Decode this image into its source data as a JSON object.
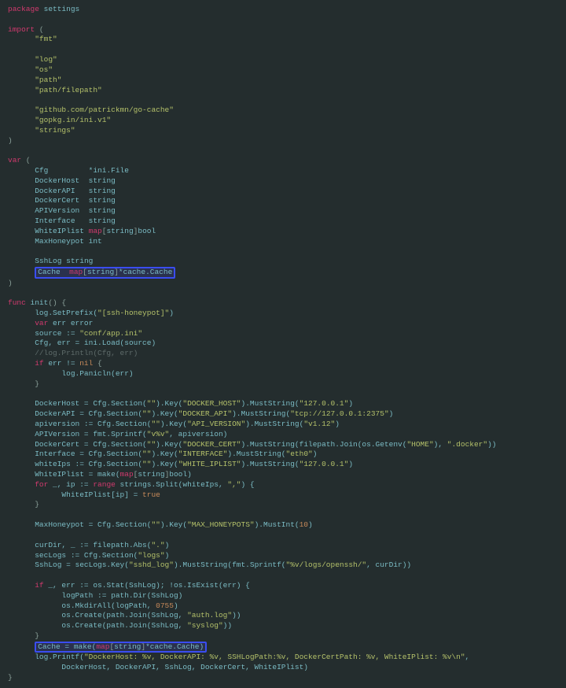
{
  "code": {
    "pkg_keyword": "package",
    "pkg_name": "settings",
    "import_keyword": "import",
    "imports": {
      "i0": "\"fmt\"",
      "i1": "\"log\"",
      "i2": "\"os\"",
      "i3": "\"path\"",
      "i4": "\"path/filepath\"",
      "i5": "\"github.com/patrickmn/go-cache\"",
      "i6": "\"gopkg.in/ini.v1\"",
      "i7": "\"strings\""
    },
    "var_keyword": "var",
    "vars": {
      "cfg_name": "Cfg",
      "cfg_type": "*ini.File",
      "dh_name": "DockerHost",
      "dh_type": "string",
      "da_name": "DockerAPI",
      "da_type": "string",
      "dc_name": "DockerCert",
      "dc_type": "string",
      "av_name": "APIVersion",
      "av_type": "string",
      "if_name": "Interface",
      "if_type": "string",
      "wip_name": "WhiteIPlist",
      "mh_name": "MaxHoneypot",
      "mh_type": "int",
      "ssh_name": "SshLog",
      "ssh_type": "string",
      "cache_name": "Cache"
    },
    "map_kw": "map",
    "string_kw": "string",
    "bool_kw": "bool",
    "cache_type": "*cache.Cache",
    "func_kw": "func",
    "init_name": "init",
    "body": {
      "l_setprefix_a": "log.SetPrefix(",
      "l_setprefix_str": "\"[ssh-honeypot]\"",
      "l_setprefix_b": ")",
      "l_var_err": "var",
      "l_err_decl": " err error",
      "l_source": "source := ",
      "l_source_str": "\"conf/app.ini\"",
      "l_cfgload_a": "Cfg, err = ini.Load(source)",
      "l_cmt": "//log.Println(Cfg, err)",
      "l_if_kw": "if",
      "l_if_cond": " err != ",
      "l_nil": "nil",
      "l_brace_open": " {",
      "l_panic": "log.Panicln(err)",
      "l_brace_close": "}",
      "l_dh": "DockerHost = Cfg.Section(",
      "s_empty": "\"\"",
      "l_key": ").Key(",
      "s_docker_host": "\"DOCKER_HOST\"",
      "l_muststr": ").MustString(",
      "s_127": "\"127.0.0.1\"",
      "l_close": ")",
      "l_da": "DockerAPI = Cfg.Section(",
      "s_docker_api": "\"DOCKER_API\"",
      "s_tcp": "\"tcp://127.0.0.1:2375\"",
      "l_apiv": "apiversion := Cfg.Section(",
      "s_api_ver": "\"API_VERSION\"",
      "s_v112": "\"v1.12\"",
      "l_apiv2": "APIVersion = fmt.Sprintf(",
      "s_vpv": "\"v%v\"",
      "l_apiv2b": ", apiversion)",
      "l_dc": "DockerCert = Cfg.Section(",
      "s_docker_cert": "\"DOCKER_CERT\"",
      "l_dc2": ").MustString(filepath.Join(os.Getenv(",
      "s_home": "\"HOME\"",
      "l_dc3": "), ",
      "s_dotdocker": "\".docker\"",
      "l_dc4": "))",
      "l_iface": "Interface = Cfg.Section(",
      "s_iface": "\"INTERFACE\"",
      "s_eth0": "\"eth0\"",
      "l_wips": "whiteIps := Cfg.Section(",
      "s_wiplist": "\"WHITE_IPLIST\"",
      "l_wipl_a": "WhiteIPlist = make(",
      "l_for_kw": "for",
      "l_for_a": " _, ip := ",
      "l_range_kw": "range",
      "l_for_b": " strings.Split(whiteIps, ",
      "s_comma": "\",\"",
      "l_for_c": ") {",
      "l_wipl_set_a": "WhiteIPlist[ip] = ",
      "l_true": "true",
      "l_maxhp_a": "MaxHoneypot = Cfg.Section(",
      "s_maxhp": "\"MAX_HONEYPOTS\"",
      "l_mustint": ").MustInt(",
      "n_10": "10",
      "l_curdir": "curDir, _ := filepath.Abs(",
      "s_dot": "\".\"",
      "l_seclogs": "secLogs := Cfg.Section(",
      "s_logs": "\"logs\"",
      "l_sshlog_a": "SshLog = secLogs.Key(",
      "s_sshd_log": "\"sshd_log\"",
      "l_sshlog_b": ").MustString(fmt.Sprintf(",
      "s_fmt_logs": "\"%v/logs/openssh/\"",
      "l_sshlog_c": ", curDir))",
      "l_ifstat_a": "if",
      "l_ifstat_b": " _, err := os.Stat(SshLog); !os.IsExist(err) {",
      "l_logpath": "logPath := path.Dir(SshLog)",
      "l_mkdir_a": "os.MkdirAll(logPath, ",
      "n_0755": "0755",
      "l_create_a": "os.Create(path.Join(SshLog, ",
      "s_authlog": "\"auth.log\"",
      "l_create_b": "))",
      "s_syslog": "\"syslog\"",
      "l_cache_make_a": "Cache = make(",
      "l_printf_a": "log.Printf(",
      "s_printf": "\"DockerHost: %v, DockerAPI: %v, SSHLogPath:%v, DockerCertPath: %v, WhiteIPlist: %v\\n\"",
      "l_printf_b": ",",
      "l_printf_c": "DockerHost, DockerAPI, SshLog, DockerCert, WhiteIPlist)"
    }
  }
}
